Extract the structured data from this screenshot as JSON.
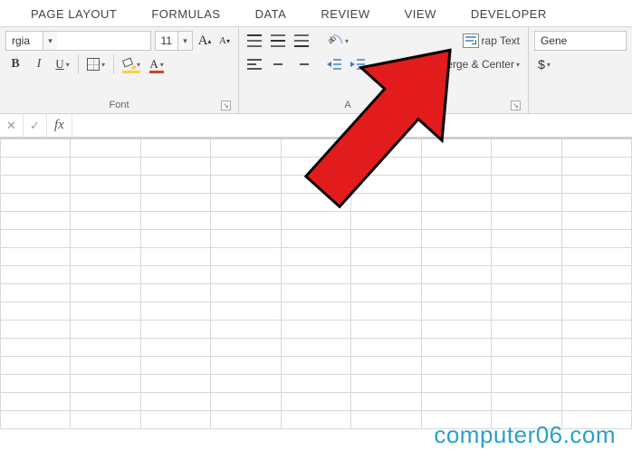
{
  "tabs": {
    "page_layout": "PAGE LAYOUT",
    "formulas": "FORMULAS",
    "data": "DATA",
    "review": "REVIEW",
    "view": "VIEW",
    "developer": "DEVELOPER"
  },
  "font": {
    "name_value": "rgia",
    "size_value": "11",
    "increase": "A",
    "decrease": "A",
    "bold": "B",
    "italic": "I",
    "underline": "U",
    "font_color_letter": "A",
    "group_label": "Font"
  },
  "alignment": {
    "orientation_text": "ab",
    "wrap_label": "rap Text",
    "merge_label": "erge & Center",
    "group_label": "A                  ment"
  },
  "number": {
    "format_value": "Gene",
    "currency": "$"
  },
  "formula_bar": {
    "fx": "fx",
    "value": ""
  },
  "watermark": "computer06.com"
}
